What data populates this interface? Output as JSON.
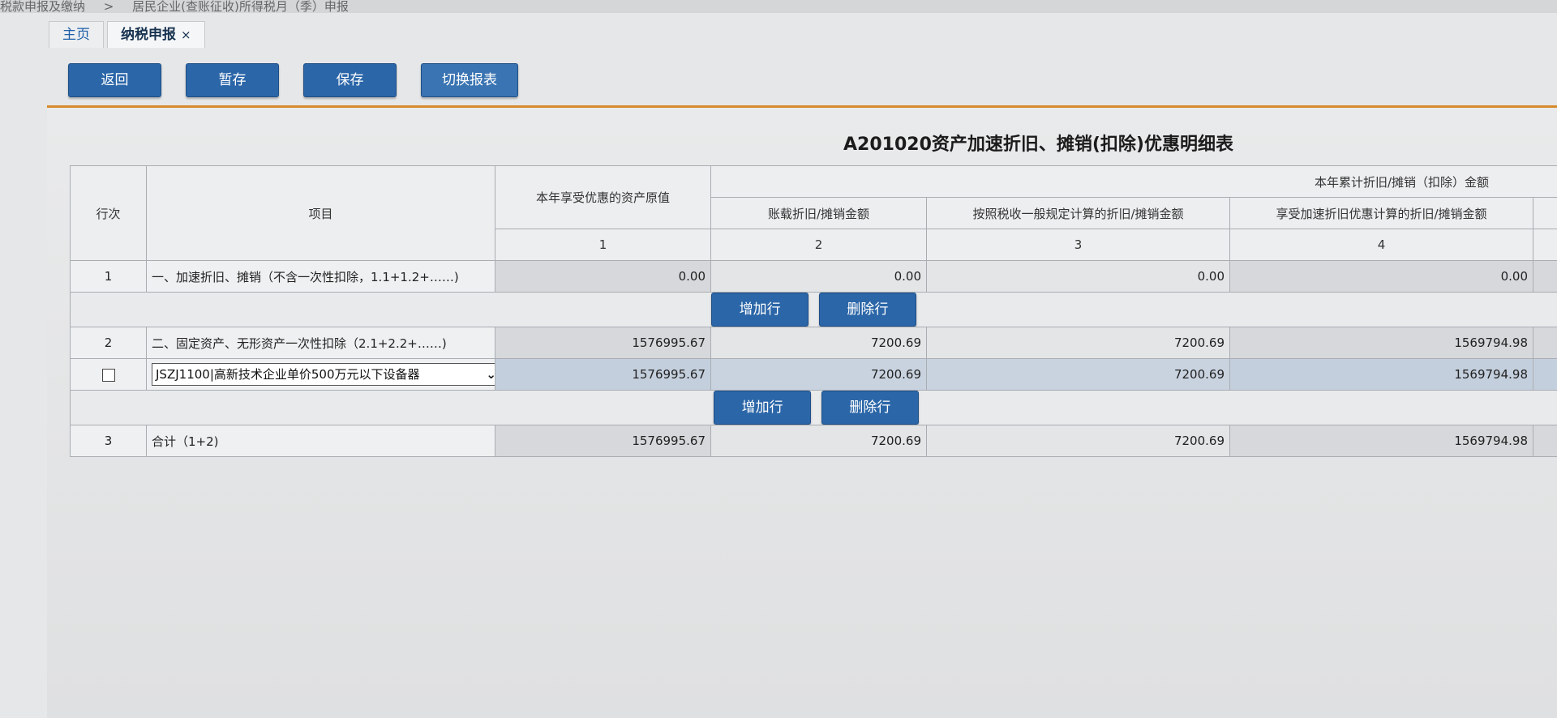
{
  "breadcrumb": {
    "items": [
      "税款申报及缴纳",
      ">",
      "居民企业(查账征收)所得税月（季）申报"
    ]
  },
  "tabs": [
    {
      "label": "主页"
    },
    {
      "label": "纳税申报",
      "close": "×"
    }
  ],
  "toolbar": {
    "back_label": "返回",
    "temp_save_label": "暂存",
    "save_label": "保存",
    "switch_label": "切换报表"
  },
  "form": {
    "title": "A201020资产加速折旧、摊销(扣除)优惠明细表",
    "headers": {
      "row_no": "行次",
      "item": "项目",
      "original_value": "本年享受优惠的资产原值",
      "cumulative_group": "本年累计折旧/摊销（扣除）金额",
      "book_amount": "账载折旧/摊销金额",
      "tax_general_amount": "按照税收一般规定计算的折旧/摊销金额",
      "accelerated_amount": "享受加速折旧优惠计算的折旧/摊销金额",
      "col1": "1",
      "col2": "2",
      "col3": "3",
      "col4": "4"
    },
    "rows": [
      {
        "no": "1",
        "item": "一、加速折旧、摊销（不含一次性扣除，1.1+1.2+……)",
        "v1": "0.00",
        "v2": "0.00",
        "v3": "0.00",
        "v4": "0.00"
      },
      {
        "no": "2",
        "item": "二、固定资产、无形资产一次性扣除（2.1+2.2+……)",
        "v1": "1576995.67",
        "v2": "7200.69",
        "v3": "7200.69",
        "v4": "1569794.98"
      },
      {
        "select_value": "JSZJ1100|高新技术企业单价500万元以下设备器",
        "v1": "1576995.67",
        "v2": "7200.69",
        "v3": "7200.69",
        "v4": "1569794.98"
      },
      {
        "no": "3",
        "item": "合计（1+2)",
        "v1": "1576995.67",
        "v2": "7200.69",
        "v3": "7200.69",
        "v4": "1569794.98"
      }
    ],
    "add_row_label": "增加行",
    "delete_row_label": "删除行"
  }
}
